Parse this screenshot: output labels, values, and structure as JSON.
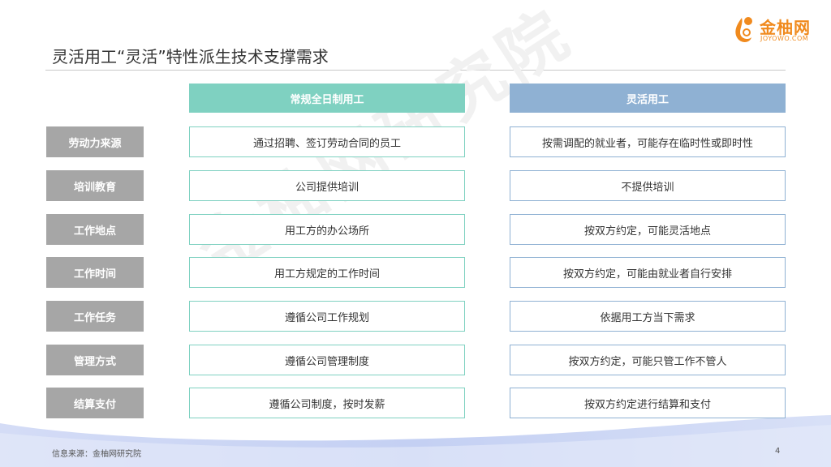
{
  "title": "灵活用工“灵活”特性派生技术支撑需求",
  "logo": {
    "name": "金柚网",
    "url": "JOYOWO.COM"
  },
  "watermark": "金柚网研究院",
  "columns": {
    "regular": "常规全日制用工",
    "flexible": "灵活用工"
  },
  "rows": [
    {
      "label": "劳动力来源",
      "regular": "通过招聘、签订劳动合同的员工",
      "flexible": "按需调配的就业者，可能存在临时性或即时性"
    },
    {
      "label": "培训教育",
      "regular": "公司提供培训",
      "flexible": "不提供培训"
    },
    {
      "label": "工作地点",
      "regular": "用工方的办公场所",
      "flexible": "按双方约定，可能灵活地点"
    },
    {
      "label": "工作时间",
      "regular": "用工方规定的工作时间",
      "flexible": "按双方约定，可能由就业者自行安排"
    },
    {
      "label": "工作任务",
      "regular": "遵循公司工作规划",
      "flexible": "依据用工方当下需求"
    },
    {
      "label": "管理方式",
      "regular": "遵循公司管理制度",
      "flexible": "按双方约定，可能只管工作不管人"
    },
    {
      "label": "结算支付",
      "regular": "遵循公司制度，按时发薪",
      "flexible": "按双方约定进行结算和支付"
    }
  ],
  "footer": {
    "source": "信息来源：金柚网研究院",
    "page": "4"
  },
  "colors": {
    "regular_accent": "#7fd1c1",
    "flexible_accent": "#8fb1d3",
    "label_bg": "#a6a6a6",
    "logo_orange": "#f08a1e",
    "wave_blue": "#cfd9f5"
  }
}
